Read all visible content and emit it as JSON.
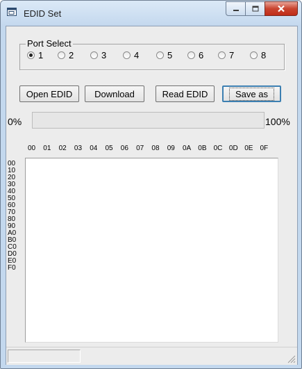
{
  "window": {
    "title": "EDID Set",
    "app_icon": "window-app-icon",
    "controls": [
      "minimize-icon",
      "maximize-icon",
      "close-icon"
    ]
  },
  "port_select": {
    "label": "Port Select",
    "options": [
      "1",
      "2",
      "3",
      "4",
      "5",
      "6",
      "7",
      "8"
    ],
    "selected": "1"
  },
  "buttons": {
    "open_edid": "Open EDID",
    "download": "Download",
    "read_edid": "Read EDID",
    "save_as": "Save as"
  },
  "progress": {
    "min_label": "0%",
    "max_label": "100%",
    "value": 0
  },
  "hex_grid": {
    "columns": [
      "00",
      "01",
      "02",
      "03",
      "04",
      "05",
      "06",
      "07",
      "08",
      "09",
      "0A",
      "0B",
      "0C",
      "0D",
      "0E",
      "0F"
    ],
    "rows": [
      "00",
      "10",
      "20",
      "30",
      "40",
      "50",
      "60",
      "70",
      "80",
      "90",
      "A0",
      "B0",
      "C0",
      "D0",
      "E0",
      "F0"
    ],
    "content": ""
  },
  "status_bar": {
    "text": ""
  },
  "colors": {
    "title_bar": "#c4d8ee",
    "close_button": "#c9442f",
    "client_bg": "#ececec",
    "default_button_border": "#3c7fb1"
  }
}
